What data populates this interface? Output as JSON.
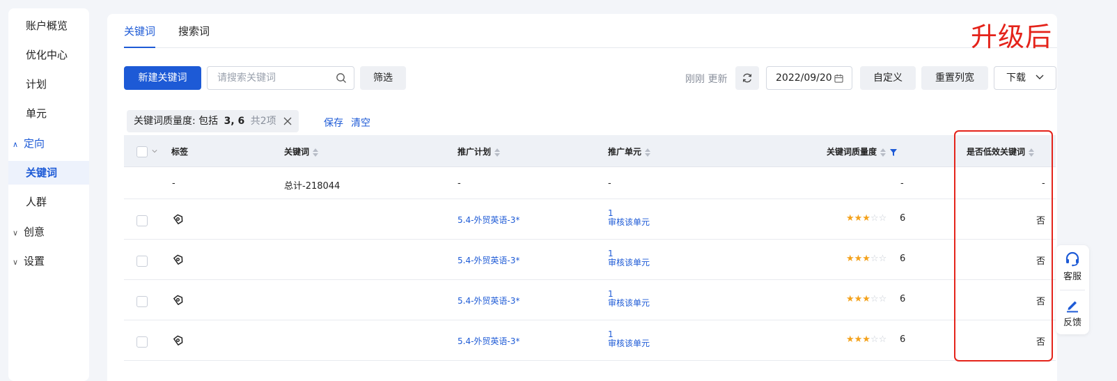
{
  "sidebar": {
    "items": [
      {
        "label": "账户概览"
      },
      {
        "label": "优化中心"
      },
      {
        "label": "计划"
      },
      {
        "label": "单元"
      },
      {
        "label": "定向",
        "group": true,
        "expanded": true
      },
      {
        "label": "关键词",
        "active": true
      },
      {
        "label": "人群"
      },
      {
        "label": "创意",
        "group": true,
        "expanded": false
      },
      {
        "label": "设置",
        "group": true,
        "expanded": false
      }
    ]
  },
  "tabs": [
    {
      "label": "关键词",
      "active": true
    },
    {
      "label": "搜索词",
      "active": false
    }
  ],
  "annotation": {
    "text": "升级后",
    "color": "#e4231a"
  },
  "toolbar": {
    "new_keyword_label": "新建关键词",
    "search_placeholder": "请搜索关键词",
    "filter_label": "筛选",
    "updated_text": "刚刚 更新",
    "date_value": "2022/09/20",
    "custom_label": "自定义",
    "reset_width_label": "重置列宽",
    "download_label": "下载"
  },
  "filter": {
    "field": "关键词质量度:",
    "op": "包括",
    "values": "3, 6",
    "count": "共2项",
    "save_label": "保存",
    "clear_label": "清空"
  },
  "table": {
    "columns": [
      {
        "label": "标签",
        "sortable": false
      },
      {
        "label": "关键词",
        "sortable": true
      },
      {
        "label": "推广计划",
        "sortable": true
      },
      {
        "label": "推广单元",
        "sortable": true
      },
      {
        "label": "关键词质量度",
        "sortable": true,
        "filtered": true
      },
      {
        "label": "是否低效关键词",
        "sortable": true
      }
    ],
    "total_row": {
      "tag": "-",
      "keyword": "总计-218044",
      "plan": "-",
      "unit": "-",
      "quality": "-",
      "low_efficiency": "-"
    },
    "rows": [
      {
        "plan": "5.4-外贸英语-3*",
        "unit_count": "1",
        "unit_action": "审核该单元",
        "stars": 3,
        "quality": "6",
        "low_efficiency": "否"
      },
      {
        "plan": "5.4-外贸英语-3*",
        "unit_count": "1",
        "unit_action": "审核该单元",
        "stars": 3,
        "quality": "6",
        "low_efficiency": "否"
      },
      {
        "plan": "5.4-外贸英语-3*",
        "unit_count": "1",
        "unit_action": "审核该单元",
        "stars": 3,
        "quality": "6",
        "low_efficiency": "否"
      },
      {
        "plan": "5.4-外贸英语-3*",
        "unit_count": "1",
        "unit_action": "审核该单元",
        "stars": 3,
        "quality": "6",
        "low_efficiency": "否"
      }
    ]
  },
  "float_service": {
    "support_label": "客服",
    "feedback_label": "反馈"
  },
  "colors": {
    "primary": "#1d5ad6",
    "star": "#f4a21c",
    "annotation": "#e4231a"
  }
}
